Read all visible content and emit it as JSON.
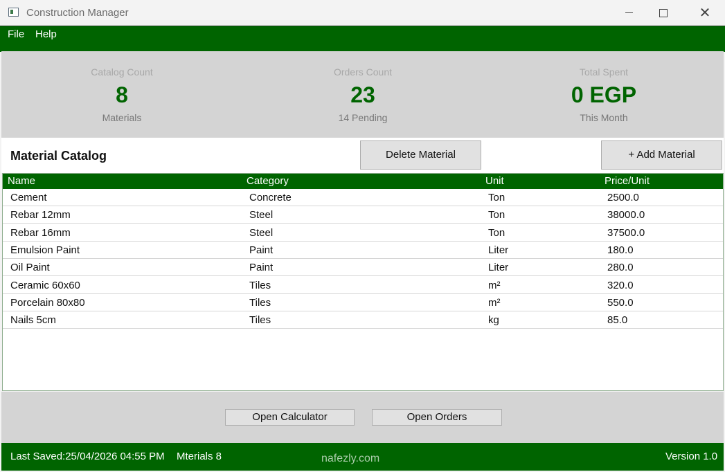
{
  "window": {
    "title": "Construction Manager"
  },
  "menu": {
    "items": [
      "File",
      "Help"
    ]
  },
  "stats": [
    {
      "label": "Catalog Count",
      "value": "8",
      "sub": "Materials"
    },
    {
      "label": "Orders Count",
      "value": "23",
      "sub": "14 Pending"
    },
    {
      "label": "Total Spent",
      "value": "0 EGP",
      "sub": "This Month"
    }
  ],
  "catalog": {
    "title": "Material Catalog",
    "delete_label": "Delete Material",
    "add_label": "+ Add Material",
    "columns": [
      "Name",
      "Category",
      "Unit",
      "Price/Unit"
    ],
    "rows": [
      [
        "Cement",
        "Concrete",
        "Ton",
        "2500.0"
      ],
      [
        "Rebar 12mm",
        "Steel",
        "Ton",
        "38000.0"
      ],
      [
        "Rebar 16mm",
        "Steel",
        "Ton",
        "37500.0"
      ],
      [
        "Emulsion Paint",
        "Paint",
        "Liter",
        "180.0"
      ],
      [
        "Oil Paint",
        "Paint",
        "Liter",
        "280.0"
      ],
      [
        "Ceramic 60x60",
        "Tiles",
        "m²",
        "320.0"
      ],
      [
        "Porcelain 80x80",
        "Tiles",
        "m²",
        "550.0"
      ],
      [
        "Nails 5cm",
        "Tiles",
        "kg",
        "85.0"
      ]
    ]
  },
  "actions": {
    "calculator_label": "Open Calculator",
    "orders_label": "Open Orders"
  },
  "status": {
    "last_saved": "Last Saved:25/04/2026 04:55 PM",
    "materials": "Mterials 8",
    "watermark": "nafezly.com",
    "version": "Version 1.0"
  },
  "colors": {
    "brand_green": "#006400",
    "panel_gray": "#d4d4d4"
  }
}
